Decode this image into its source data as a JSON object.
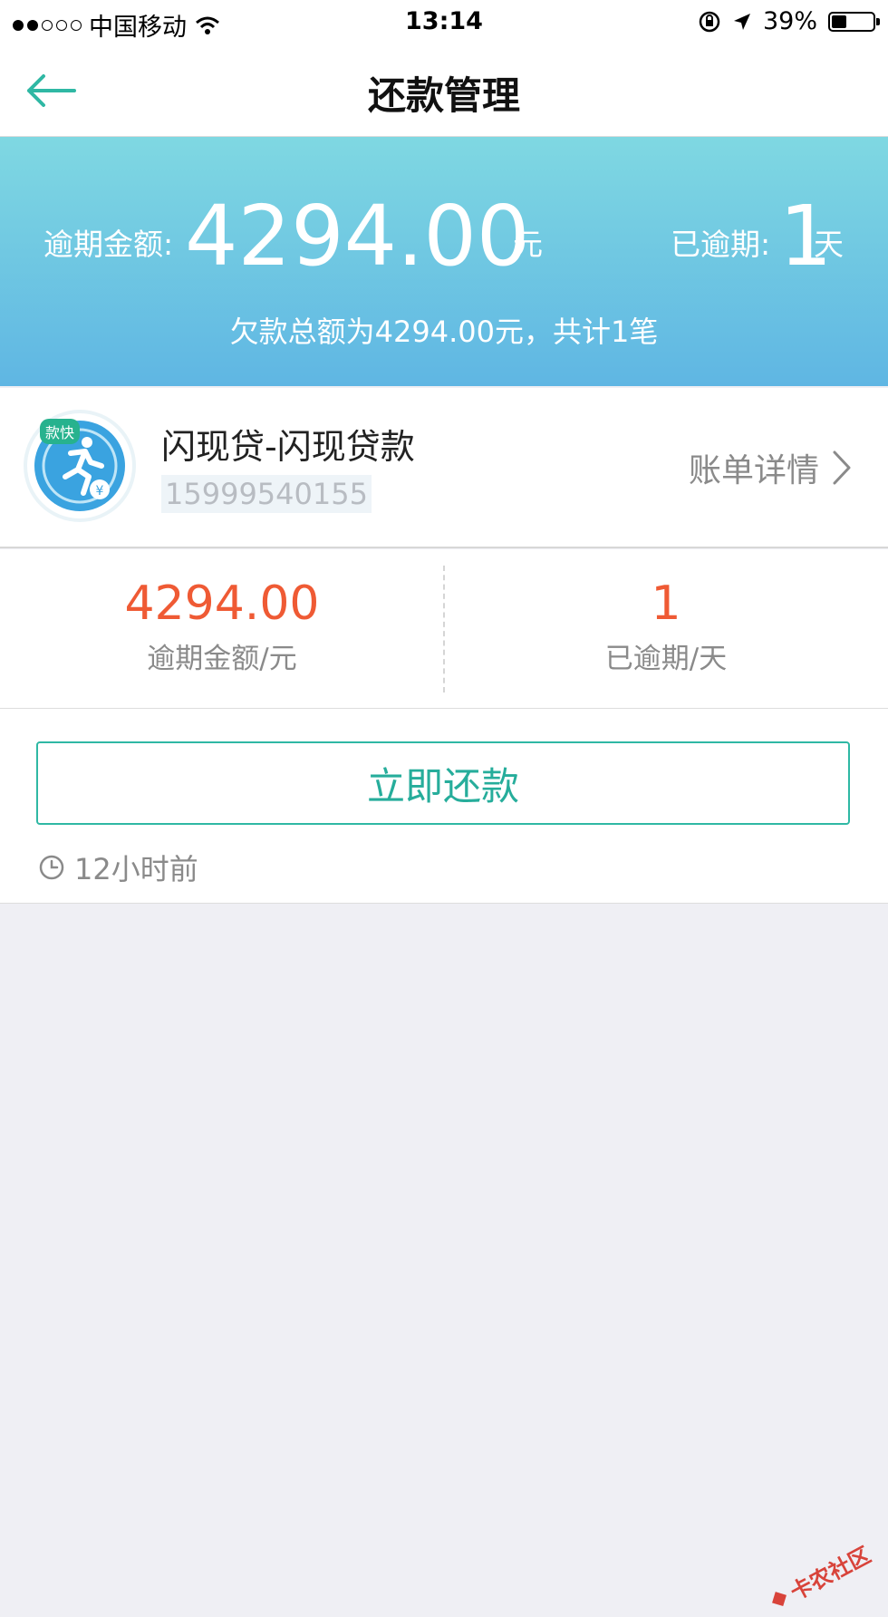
{
  "status_bar": {
    "carrier": "中国移动",
    "time": "13:14",
    "battery": "39%",
    "battery_level": 0.39
  },
  "nav": {
    "title": "还款管理"
  },
  "banner": {
    "overdue_amount_label": "逾期金额:",
    "overdue_amount": "4294.00",
    "amount_unit": "元",
    "overdue_days_label": "已逾期:",
    "overdue_days": "1",
    "days_unit": "天",
    "summary": "欠款总额为4294.00元，共计1笔"
  },
  "loan": {
    "name": "闪现贷-闪现贷款",
    "phone": "15999540155",
    "detail_link": "账单详情",
    "logo_badge": "款快",
    "logo_currency": "¥"
  },
  "stats": {
    "amount_value": "4294.00",
    "amount_label": "逾期金额/元",
    "days_value": "1",
    "days_label": "已逾期/天"
  },
  "action": {
    "repay_button": "立即还款",
    "timestamp": "12小时前"
  },
  "watermark": "卡农社区",
  "colors": {
    "accent_teal": "#2fb8a4",
    "overdue_red": "#ef5a34",
    "banner_top": "#7fd8e2",
    "banner_bottom": "#5fb6e3"
  }
}
